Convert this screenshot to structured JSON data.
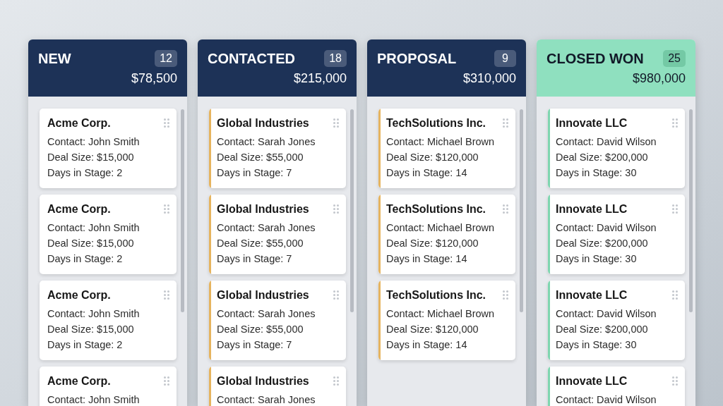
{
  "columns": [
    {
      "title": "NEW",
      "count": "12",
      "total": "$78,500",
      "header": {
        "color": "#1d3257"
      },
      "cards": [
        {
          "company": "Acme Corp.",
          "details": [
            "Contact: John Smith",
            "Deal Size: $15,000",
            "Days in Stage: 2"
          ]
        },
        {
          "company": "Acme Corp.",
          "details": [
            "Contact: John Smith",
            "Deal Size: $15,000",
            "Days in Stage: 2"
          ]
        },
        {
          "company": "Acme Corp.",
          "details": [
            "Contact: John Smith",
            "Deal Size: $15,000",
            "Days in Stage: 2"
          ]
        },
        {
          "company": "Acme Corp.",
          "details": [
            "Contact: John Smith"
          ]
        }
      ]
    },
    {
      "title": "CONTACTED",
      "count": "18",
      "total": "$215,000",
      "header": {
        "color": "#1d3257"
      },
      "stripe": {
        "color": "#e6b45f"
      },
      "cards": [
        {
          "company": "Global Industries",
          "details": [
            "Contact: Sarah Jones",
            "Deal Size: $55,000",
            "Days in Stage: 7"
          ]
        },
        {
          "company": "Global Industries",
          "details": [
            "Contact: Sarah Jones",
            "Deal Size: $55,000",
            "Days in Stage: 7"
          ]
        },
        {
          "company": "Global Industries",
          "details": [
            "Contact: Sarah Jones",
            "Deal Size: $55,000",
            "Days in Stage: 7"
          ]
        },
        {
          "company": "Global Industries",
          "details": [
            "Contact: Sarah Jones"
          ]
        }
      ]
    },
    {
      "title": "PROPOSAL",
      "count": "9",
      "total": "$310,000",
      "header": {
        "color": "#1d3257"
      },
      "stripe": {
        "color": "#e6b45f"
      },
      "cards": [
        {
          "company": "TechSolutions Inc.",
          "details": [
            "Contact: Michael Brown",
            "Deal Size: $120,000",
            "Days in Stage: 14"
          ]
        },
        {
          "company": "TechSolutions Inc.",
          "details": [
            "Contact: Michael Brown",
            "Deal Size: $120,000",
            "Days in Stage: 14"
          ]
        },
        {
          "company": "TechSolutions Inc.",
          "details": [
            "Contact: Michael Brown",
            "Deal Size: $120,000",
            "Days in Stage: 14"
          ]
        }
      ]
    },
    {
      "title": "CLOSED WON",
      "count": "25",
      "total": "$980,000",
      "header": {
        "color": "#8fe0bf"
      },
      "stripe": {
        "color": "#7fd6b0"
      },
      "cards": [
        {
          "company": "Innovate LLC",
          "details": [
            "Contact: David Wilson",
            "Deal Size: $200,000",
            "Days in Stage: 30"
          ]
        },
        {
          "company": "Innovate LLC",
          "details": [
            "Contact: David Wilson",
            "Deal Size: $200,000",
            "Days in Stage: 30"
          ]
        },
        {
          "company": "Innovate LLC",
          "details": [
            "Contact: David Wilson",
            "Deal Size: $200,000",
            "Days in Stage: 30"
          ]
        },
        {
          "company": "Innovate LLC",
          "details": [
            "Contact: David Wilson"
          ]
        }
      ]
    }
  ]
}
